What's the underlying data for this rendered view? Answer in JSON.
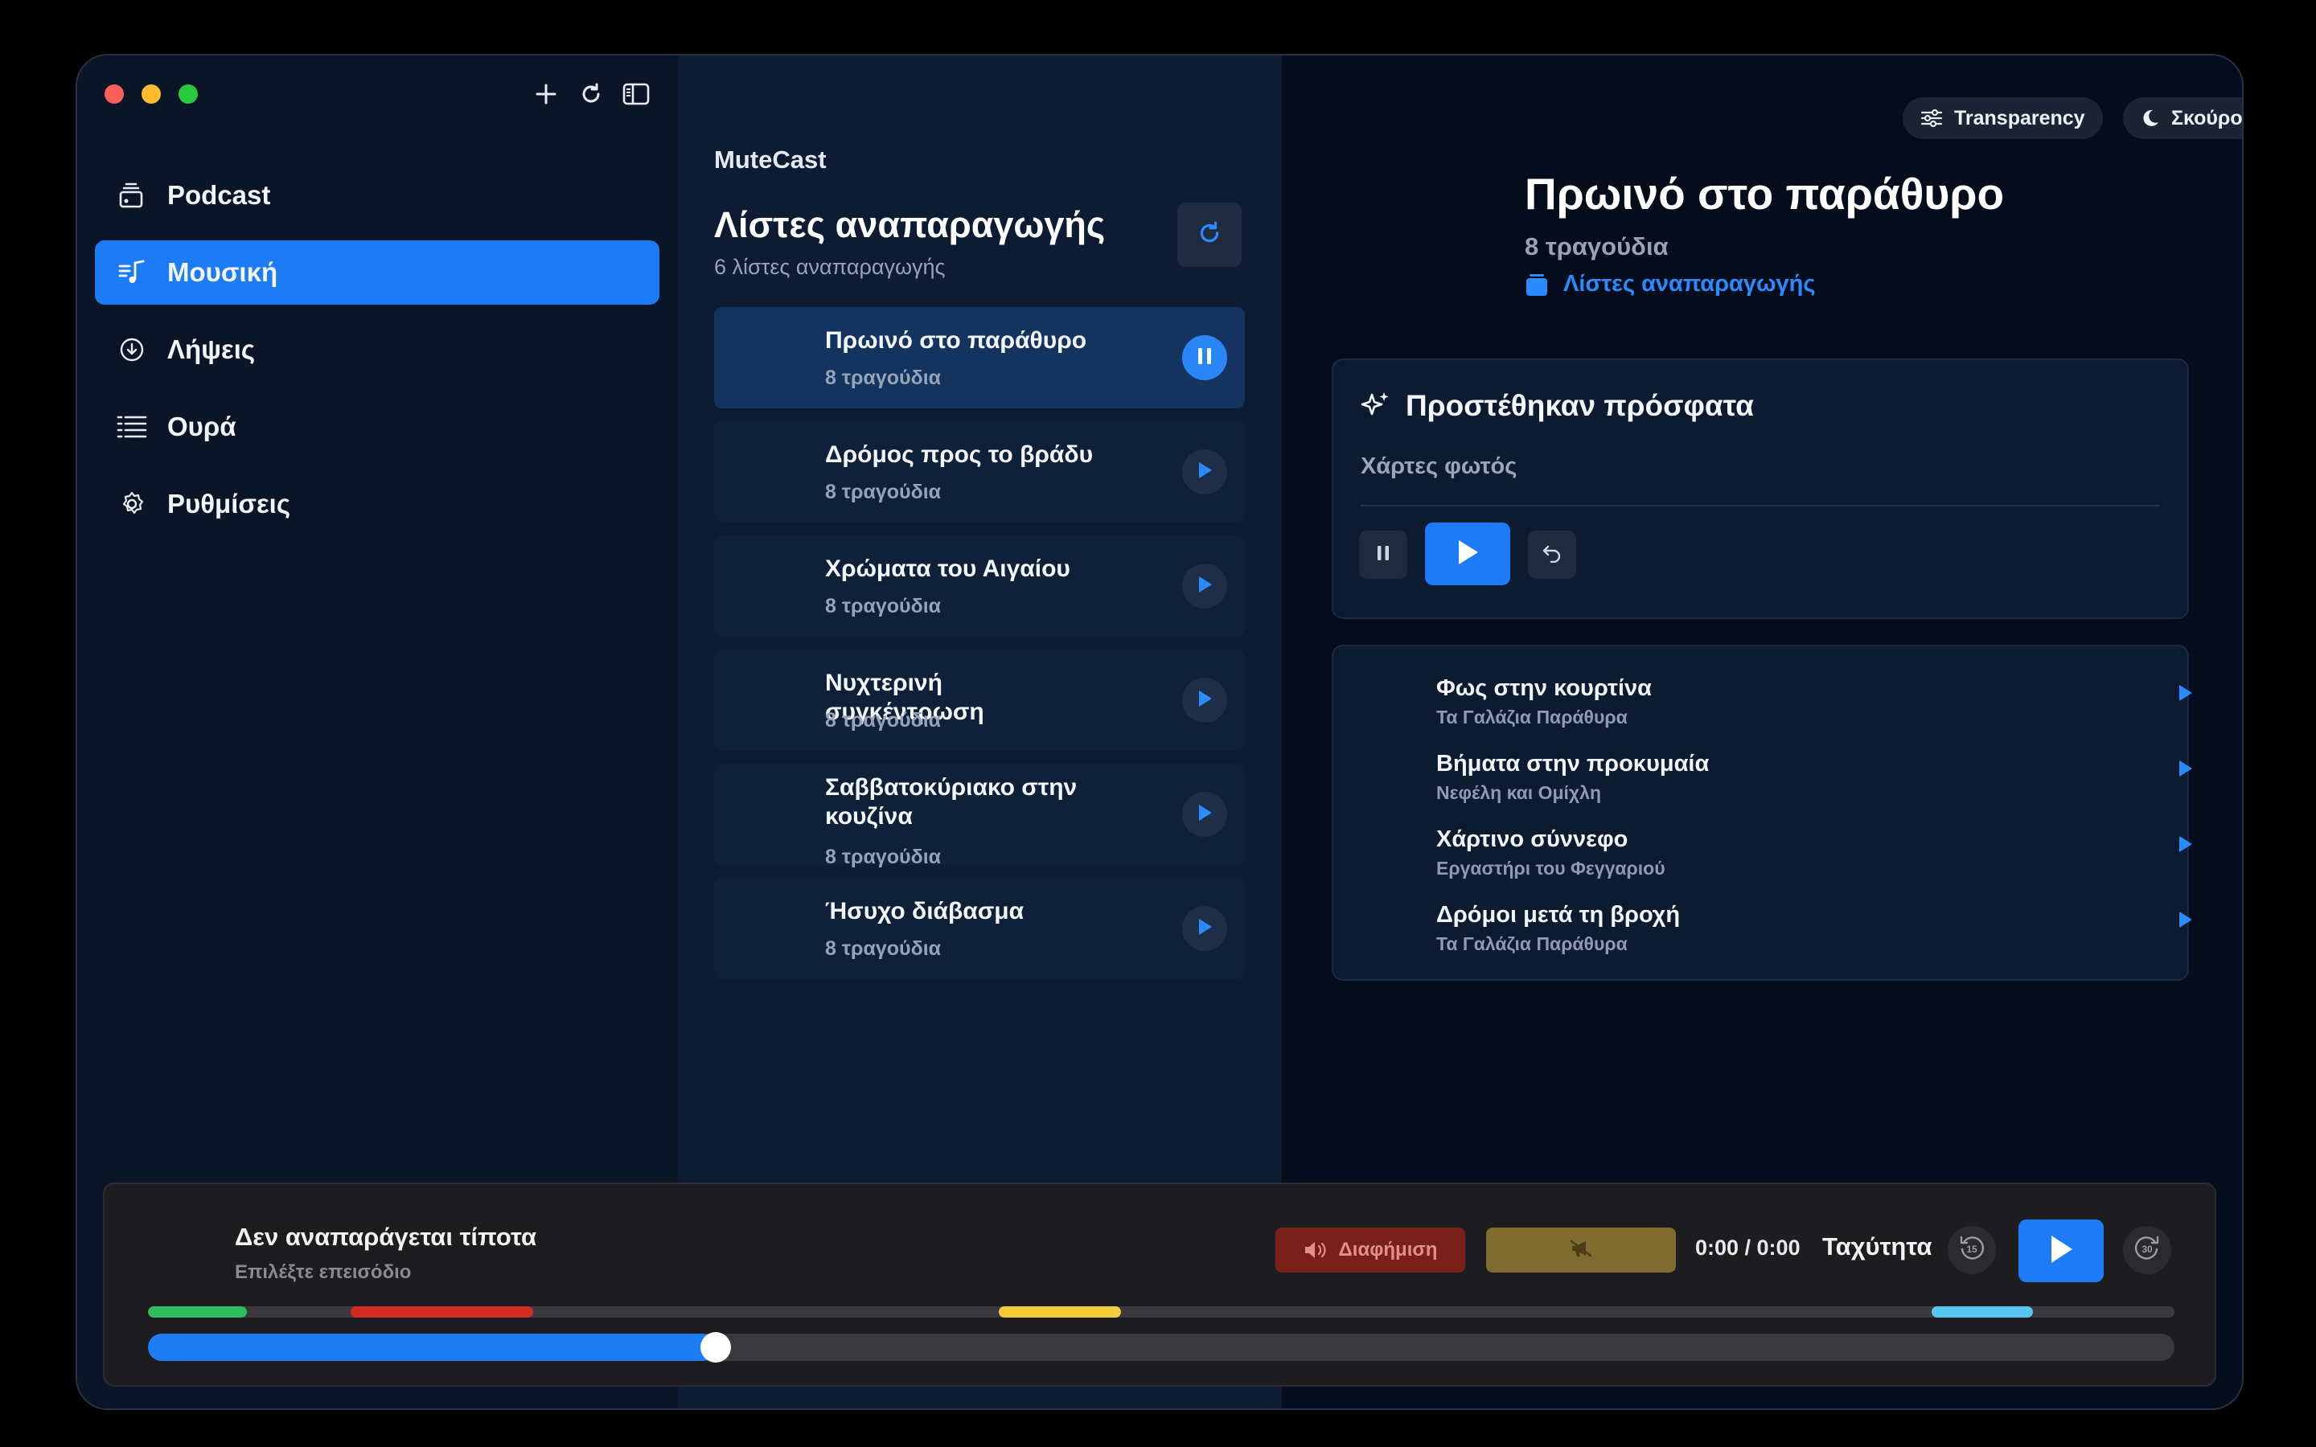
{
  "sidebar": {
    "items": [
      {
        "label": "Podcast",
        "icon": "podcast-stack-icon"
      },
      {
        "label": "Μουσική",
        "icon": "music-list-icon",
        "active": true
      },
      {
        "label": "Λήψεις",
        "icon": "download-icon"
      },
      {
        "label": "Ουρά",
        "icon": "queue-list-icon"
      },
      {
        "label": "Ρυθμίσεις",
        "icon": "gear-icon"
      }
    ]
  },
  "library": {
    "app_name": "MuteCast",
    "title": "Λίστες αναπαραγωγής",
    "count": "6 λίστες αναπαραγωγής",
    "playlists": [
      {
        "title": "Πρωινό στο παράθυρο",
        "subtitle": "8 τραγούδια",
        "playing": true
      },
      {
        "title": "Δρόμος προς το βράδυ",
        "subtitle": "8 τραγούδια"
      },
      {
        "title": "Χρώματα του Αιγαίου",
        "subtitle": "8 τραγούδια"
      },
      {
        "title": "Νυχτερινή συγκέντρωση",
        "subtitle": "8 τραγούδια"
      },
      {
        "title": "Σαββατοκύριακο στην κουζίνα",
        "subtitle": "8 τραγούδια"
      },
      {
        "title": "Ήσυχο διάβασμα",
        "subtitle": "8 τραγούδια"
      }
    ]
  },
  "detail": {
    "transparency_label": "Transparency",
    "theme_label": "Σκούρο",
    "title": "Πρωινό στο παράθυρο",
    "subtitle": "8 τραγούδια",
    "breadcrumb": "Λίστες αναπαραγωγής",
    "recent": {
      "header": "Προστέθηκαν πρόσφατα",
      "track": "Χάρτες φωτός"
    },
    "songs": [
      {
        "name": "Φως στην κουρτίνα",
        "artist": "Τα Γαλάζια Παράθυρα"
      },
      {
        "name": "Βήματα στην προκυμαία",
        "artist": "Νεφέλη και Ομίχλη"
      },
      {
        "name": "Χάρτινο σύννεφο",
        "artist": "Εργαστήρι του Φεγγαριού"
      },
      {
        "name": "Δρόμοι μετά τη βροχή",
        "artist": "Τα Γαλάζια Παράθυρα"
      }
    ]
  },
  "player": {
    "title": "Δεν αναπαράγεται τίποτα",
    "subtitle": "Επιλέξτε επεισόδιο",
    "mute_label": "Διαφήμιση",
    "time": "0:00 / 0:00",
    "speed_label": "Ταχύτητα",
    "skip_back_seconds": "15",
    "skip_forward_seconds": "30",
    "progress_fraction": 0.28,
    "segments": [
      {
        "start": 0.0,
        "end": 0.049,
        "color": "#2ebd5f"
      },
      {
        "start": 0.1,
        "end": 0.19,
        "color": "#d32a22"
      },
      {
        "start": 0.42,
        "end": 0.48,
        "color": "#f5cf3a"
      },
      {
        "start": 0.88,
        "end": 0.93,
        "color": "#56c8f2"
      }
    ]
  },
  "colors": {
    "accent": "#1d7cf5",
    "link": "#2a8bff",
    "mute": "#7a1f1a",
    "skip_segment": "#7f6a2f"
  }
}
